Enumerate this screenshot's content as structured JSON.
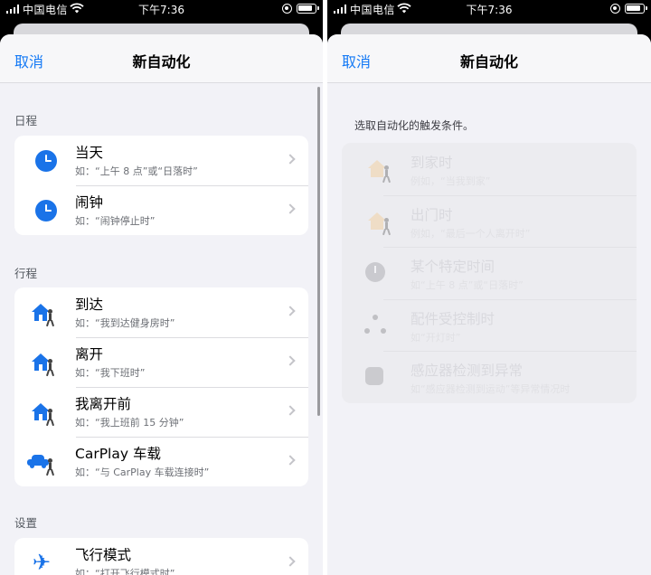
{
  "status_bar": {
    "carrier": "中国电信",
    "time": "下午7:36"
  },
  "left": {
    "nav": {
      "cancel": "取消",
      "title": "新自动化"
    },
    "sections": [
      {
        "header": "日程",
        "rows": [
          {
            "title": "当天",
            "subtitle": "如：“上午 8 点”或“日落时”",
            "icon": "clock-icon"
          },
          {
            "title": "闹钟",
            "subtitle": "如：“闹钟停止时”",
            "icon": "clock-icon"
          }
        ]
      },
      {
        "header": "行程",
        "rows": [
          {
            "title": "到达",
            "subtitle": "如：“我到达健身房时”",
            "icon": "house-walker-icon"
          },
          {
            "title": "离开",
            "subtitle": "如：“我下班时”",
            "icon": "house-walker-icon"
          },
          {
            "title": "我离开前",
            "subtitle": "如：“我上班前 15 分钟”",
            "icon": "house-walker-icon"
          },
          {
            "title": "CarPlay 车载",
            "subtitle": "如：“与 CarPlay 车载连接时”",
            "icon": "car-walker-icon"
          }
        ]
      },
      {
        "header": "设置",
        "rows": [
          {
            "title": "飞行模式",
            "subtitle": "如：“打开飞行模式时”",
            "icon": "airplane-icon"
          }
        ]
      }
    ]
  },
  "right": {
    "nav": {
      "cancel": "取消",
      "title": "新自动化"
    },
    "instruction": "选取自动化的触发条件。",
    "triggers": [
      {
        "title": "到家时",
        "subtitle": "例如，“当我到家”",
        "icon": "home-arrive-icon"
      },
      {
        "title": "出门时",
        "subtitle": "例如，“最后一个人离开时”",
        "icon": "home-leave-icon"
      },
      {
        "title": "某个特定时间",
        "subtitle": "如“上午 8 点”或“日落时”",
        "icon": "clock-icon"
      },
      {
        "title": "配件受控制时",
        "subtitle": "如“开灯时”",
        "icon": "accessory-icon"
      },
      {
        "title": "感应器检测到异常",
        "subtitle": "如“感应器检测到运动”等异常情况时",
        "icon": "sensor-icon"
      }
    ]
  }
}
